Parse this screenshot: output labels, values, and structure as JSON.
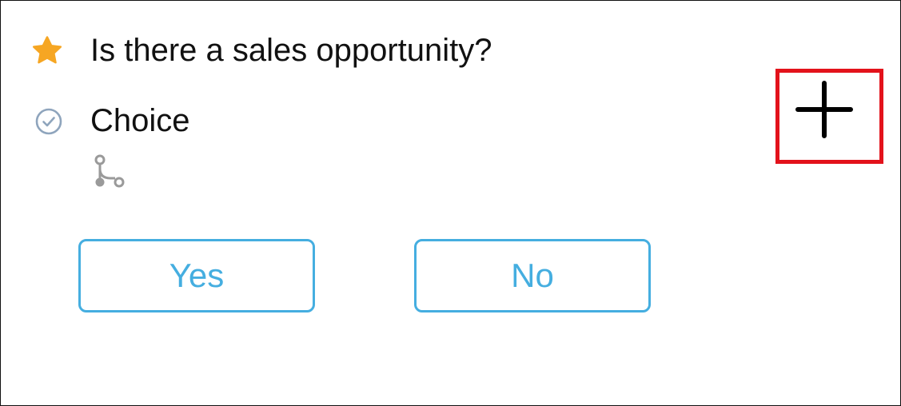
{
  "question": {
    "text": "Is there a sales opportunity?",
    "icon": "star-icon",
    "icon_color": "#f6a623"
  },
  "choice": {
    "label": "Choice",
    "icon": "check-circle-icon",
    "icon_color": "#8fa5bd"
  },
  "branch": {
    "icon": "branch-icon",
    "icon_color": "#9a9a9a"
  },
  "add_button": {
    "icon": "plus-icon",
    "highlight_color": "#e3121b"
  },
  "answers": [
    {
      "label": "Yes"
    },
    {
      "label": "No"
    }
  ],
  "colors": {
    "accent": "#45aee0",
    "text": "#111111"
  }
}
